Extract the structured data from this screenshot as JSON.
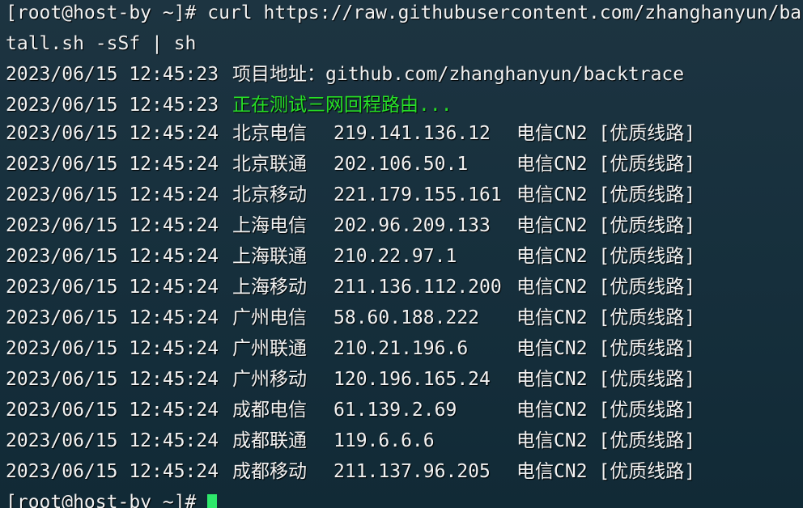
{
  "terminal": {
    "command_line_1": "[root@host-by ~]# curl https://raw.githubusercontent.com/zhanghanyun/backtrace/main/ins",
    "command_line_2": "tall.sh -sSf | sh",
    "info": [
      {
        "timestamp": "2023/06/15 12:45:23",
        "label": "项目地址：",
        "value": "github.com/zhanghanyun/backtrace"
      },
      {
        "timestamp": "2023/06/15 12:45:23",
        "text": "正在测试三网回程路由..."
      }
    ],
    "routes": [
      {
        "timestamp": "2023/06/15 12:45:24",
        "name": "北京电信",
        "ip": "219.141.136.12",
        "type": "电信CN2 [优质线路]"
      },
      {
        "timestamp": "2023/06/15 12:45:24",
        "name": "北京联通",
        "ip": "202.106.50.1",
        "type": "电信CN2 [优质线路]"
      },
      {
        "timestamp": "2023/06/15 12:45:24",
        "name": "北京移动",
        "ip": "221.179.155.161",
        "type": "电信CN2 [优质线路]"
      },
      {
        "timestamp": "2023/06/15 12:45:24",
        "name": "上海电信",
        "ip": "202.96.209.133",
        "type": "电信CN2 [优质线路]"
      },
      {
        "timestamp": "2023/06/15 12:45:24",
        "name": "上海联通",
        "ip": "210.22.97.1",
        "type": "电信CN2 [优质线路]"
      },
      {
        "timestamp": "2023/06/15 12:45:24",
        "name": "上海移动",
        "ip": "211.136.112.200",
        "type": "电信CN2 [优质线路]"
      },
      {
        "timestamp": "2023/06/15 12:45:24",
        "name": "广州电信",
        "ip": "58.60.188.222",
        "type": "电信CN2 [优质线路]"
      },
      {
        "timestamp": "2023/06/15 12:45:24",
        "name": "广州联通",
        "ip": "210.21.196.6",
        "type": "电信CN2 [优质线路]"
      },
      {
        "timestamp": "2023/06/15 12:45:24",
        "name": "广州移动",
        "ip": "120.196.165.24",
        "type": "电信CN2 [优质线路]"
      },
      {
        "timestamp": "2023/06/15 12:45:24",
        "name": "成都电信",
        "ip": "61.139.2.69",
        "type": "电信CN2 [优质线路]"
      },
      {
        "timestamp": "2023/06/15 12:45:24",
        "name": "成都联通",
        "ip": "119.6.6.6",
        "type": "电信CN2 [优质线路]"
      },
      {
        "timestamp": "2023/06/15 12:45:24",
        "name": "成都移动",
        "ip": "211.137.96.205",
        "type": "电信CN2 [优质线路]"
      }
    ],
    "prompt": "[root@host-by ~]#"
  },
  "colors": {
    "background": "#17303d",
    "text": "#f2f2f2",
    "highlight": "#27e027",
    "cursor": "#2ee86b"
  }
}
